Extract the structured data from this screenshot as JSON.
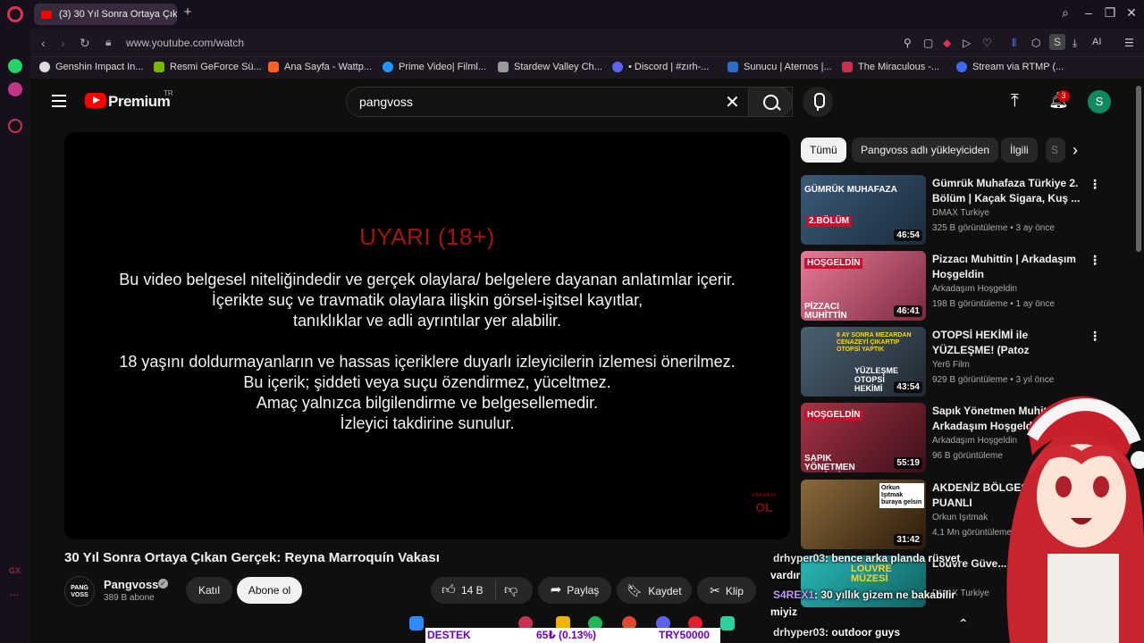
{
  "browser": {
    "tab_title": "(3) 30 Yıl Sonra Ortaya Çık",
    "url": "www.youtube.com/watch",
    "ai_label": "AI",
    "profile_letter": "S",
    "sidebar_gx": "GX",
    "sidebar_more": "...",
    "bookmarks": [
      "Genshin Impact In...",
      "Resmi GeForce Sü...",
      "Ana Sayfa - Wattp...",
      "Prime Video| Filml...",
      "Stardew Valley Ch...",
      "• Discord | #zırh-...",
      "Sunucu | Aternos |...",
      "The Miraculous -...",
      "Stream via RTMP (..."
    ]
  },
  "header": {
    "logo_text": "Premium",
    "region": "TR",
    "search_value": "pangvoss",
    "notification_count": "3",
    "avatar_letter": "S"
  },
  "player": {
    "warning_title": "UYARI (18+)",
    "lines": [
      "Bu video belgesel niteliğindedir ve gerçek olaylara/ belgelere dayanan anlatımlar içerir.",
      "İçerikte suç ve travmatik olaylara ilişkin görsel-işitsel kayıtlar,",
      "tanıklıklar ve adli ayrıntılar yer alabilir.",
      "18 yaşını doldurmayanların ve hassas içeriklere duyarlı izleyicilerin izlemesi önerilmez.",
      "Bu içerik; şiddeti veya suçu özendirmez, yüceltmez.",
      "Amaç yalnızca bilgilendirme ve belgesellemedir.",
      "İzleyici takdirine sunulur."
    ],
    "watermark_top": "KARANLIK",
    "watermark_bottom": "OL"
  },
  "video": {
    "title": "30 Yıl Sonra Ortaya Çıkan Gerçek: Reyna Marroquín Vakası",
    "channel": "Pangvoss",
    "channel_avatar_text": "PANG VOSS",
    "subscribers": "389 B abone",
    "join_label": "Katıl",
    "subscribe_label": "Abone ol",
    "likes": "14 B",
    "share_label": "Paylaş",
    "save_label": "Kaydet",
    "clip_label": "Klip"
  },
  "chips": [
    "Tümü",
    "Pangvoss adlı yükleyiciden",
    "İlgili",
    "S"
  ],
  "recommended": [
    {
      "title": "Gümrük Muhafaza Türkiye 2. Bölüm | Kaçak Sigara, Kuş ...",
      "channel": "DMAX Turkiye",
      "meta": "325 B görüntüleme • 3 ay önce",
      "duration": "46:54",
      "thumb_text": "GÜMRÜK MUHAFAZA",
      "thumb_sub": "2.BÖLÜM",
      "color": "#2c4a63"
    },
    {
      "title": "Pizzacı Muhittin | Arkadaşım Hoşgeldin",
      "channel": "Arkadaşım Hoşgeldin",
      "meta": "198 B görüntüleme • 1 ay önce",
      "duration": "46:41",
      "thumb_text": "HOŞGELDİN",
      "thumb_sub": "PİZZACI MUHİTTİN",
      "color": "#b84a6a"
    },
    {
      "title": "OTOPSİ HEKİMİ ile YÜZLEŞME! (Patoz Makinesinden Geçmiş ...",
      "channel": "Yer6 Film",
      "meta": "929 B görüntüleme • 3 yıl önce",
      "duration": "43:54",
      "thumb_text": "6 AY SONRA MEZARDAN CENAZEYİ ÇIKARTIP OTOPSİ YAPTIK",
      "thumb_sub": "YÜZLEŞME OTOPSİ HEKİMİ",
      "color": "#3d4f5f"
    },
    {
      "title": "Sapık Yönetmen Muhittin | Arkadaşım Hoşgeldin",
      "channel": "Arkadaşım Hoşgeldin",
      "meta": "96 B görüntüleme",
      "duration": "55:19",
      "thumb_text": "HOŞGELDİN",
      "thumb_sub": "SAPIK YÖNETMEN MUHİTTİN",
      "color": "#8a2a3a"
    },
    {
      "title": "AKDENİZ BÖLGESİ DÜŞÜK PUANLI",
      "channel": "Orkun Işıtmak",
      "meta": "4,1 Mn görüntüleme",
      "duration": "31:42",
      "thumb_text": "Orkun Işıtmak buraya gelsin",
      "thumb_sub": "",
      "color": "#6b4a2a"
    },
    {
      "title": "Louvre Güve... Şok Edici Fil...",
      "channel": "DMAX Turkiye",
      "meta": "",
      "duration": "",
      "thumb_text": "LOUVRE MÜZESİ",
      "thumb_sub": "",
      "color": "#1f8a8a"
    }
  ],
  "overlay": {
    "chat": [
      {
        "user": "drhyper03",
        "text": ": bence arka planda rüsvet"
      },
      {
        "user": "",
        "text": "vardır"
      },
      {
        "user": "S4REX1",
        "text": ": 30 yıllık gizem ne bakabilir"
      },
      {
        "user": "",
        "text": "miyiz"
      },
      {
        "user": "drhyper03",
        "text": ": outdoor guys"
      }
    ],
    "ticker": {
      "label": "DESTEK",
      "amount": "65₺ (0.13%)",
      "goal": "TRY50000"
    }
  },
  "colors": {
    "accent": "#ff0000",
    "warning_red": "#a31515",
    "bg": "#0f0f0f",
    "ticker_text": "#6a00c8"
  }
}
